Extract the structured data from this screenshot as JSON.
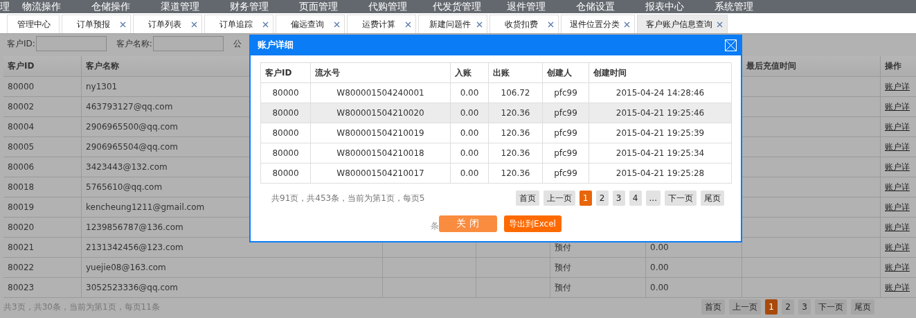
{
  "nav": [
    "理",
    "物流操作",
    "仓储操作",
    "渠道管理",
    "财务管理",
    "页面管理",
    "代购管理",
    "代发货管理",
    "退件管理",
    "仓储设置",
    "报表中心",
    "系统管理"
  ],
  "tabs": [
    {
      "label": "管理中心",
      "closable": false,
      "selected": false
    },
    {
      "label": "订单预报",
      "closable": true,
      "selected": false
    },
    {
      "label": "订单列表",
      "closable": true,
      "selected": false
    },
    {
      "label": "订单追踪",
      "closable": true,
      "selected": false
    },
    {
      "label": "偏远查询",
      "closable": true,
      "selected": false
    },
    {
      "label": "运费计算",
      "closable": true,
      "selected": false
    },
    {
      "label": "新建问题件",
      "closable": true,
      "selected": false
    },
    {
      "label": "收货扣费",
      "closable": true,
      "selected": false
    },
    {
      "label": "退件位置分类",
      "closable": true,
      "selected": false
    },
    {
      "label": "客户账户信息查询",
      "closable": true,
      "selected": true
    }
  ],
  "search": {
    "fields": [
      {
        "label": "客户ID:",
        "kind": "input"
      },
      {
        "label": "客户名称:",
        "kind": "input"
      },
      {
        "label": "公",
        "kind": "label"
      }
    ]
  },
  "table": {
    "columns": [
      "客户ID",
      "客户名称",
      "最后充值时间",
      "操作"
    ],
    "rows": [
      {
        "id": "80000",
        "name": "ny1301",
        "action": "账户详"
      },
      {
        "id": "80002",
        "name": "463793127@qq.com",
        "action": "账户详"
      },
      {
        "id": "80004",
        "name": "2906965500@qq.com",
        "action": "账户详"
      },
      {
        "id": "80005",
        "name": "2906965504@qq.com",
        "action": "账户详"
      },
      {
        "id": "80006",
        "name": "3423443@132.com",
        "action": "账户详"
      },
      {
        "id": "80018",
        "name": "5765610@qq.com",
        "action": "账户详"
      },
      {
        "id": "80019",
        "name": "kencheung1211@gmail.com",
        "action": "账户详"
      },
      {
        "id": "80020",
        "name": "1239856787@136.com",
        "action": "账户详"
      },
      {
        "id": "80021",
        "name": "2131342456@123.com",
        "column_5": "预付",
        "column_6": "0.00",
        "action": "账户详"
      },
      {
        "id": "80022",
        "name": "yuejie08@163.com",
        "column_5": "预付",
        "column_6": "0.00",
        "action": "账户详"
      },
      {
        "id": "80023",
        "name": "3052523336@qq.com",
        "column_5": "预付",
        "column_6": "0.00",
        "action": "账户详"
      }
    ]
  },
  "pager": {
    "info": "共3页，共30条，当前为第1页，每页11条",
    "buttons": [
      {
        "label": "首页",
        "kind": "nav",
        "selected": false
      },
      {
        "label": "上一页",
        "kind": "nav",
        "selected": false
      },
      {
        "label": "1",
        "kind": "page",
        "selected": true
      },
      {
        "label": "2",
        "kind": "page",
        "selected": false
      },
      {
        "label": "3",
        "kind": "page",
        "selected": false
      },
      {
        "label": "下一页",
        "kind": "nav",
        "selected": false
      },
      {
        "label": "尾页",
        "kind": "nav",
        "selected": false
      }
    ]
  },
  "dialog": {
    "title": "账户详细",
    "columns": [
      "客户ID",
      "流水号",
      "入账",
      "出账",
      "创建人",
      "创建时间"
    ],
    "rows": [
      {
        "cells": [
          "80000",
          "W800001504240001",
          "0.00",
          "106.72",
          "pfc99",
          "2015-04-24 14:28:46"
        ],
        "selected": false
      },
      {
        "cells": [
          "80000",
          "W800001504210020",
          "0.00",
          "120.36",
          "pfc99",
          "2015-04-21 19:25:46"
        ],
        "selected": true
      },
      {
        "cells": [
          "80000",
          "W800001504210019",
          "0.00",
          "120.36",
          "pfc99",
          "2015-04-21 19:25:39"
        ],
        "selected": false
      },
      {
        "cells": [
          "80000",
          "W800001504210018",
          "0.00",
          "120.36",
          "pfc99",
          "2015-04-21 19:25:34"
        ],
        "selected": false
      },
      {
        "cells": [
          "80000",
          "W800001504210017",
          "0.00",
          "120.36",
          "pfc99",
          "2015-04-21 19:25:28"
        ],
        "selected": false
      }
    ],
    "pager": {
      "info": "共91页，共453条，当前为第1页，每页5",
      "buttons": [
        {
          "label": "首页",
          "kind": "nav",
          "selected": false
        },
        {
          "label": "上一页",
          "kind": "nav",
          "selected": false
        },
        {
          "label": "1",
          "kind": "page",
          "selected": true
        },
        {
          "label": "2",
          "kind": "page",
          "selected": false
        },
        {
          "label": "3",
          "kind": "page",
          "selected": false
        },
        {
          "label": "4",
          "kind": "page",
          "selected": false
        },
        {
          "label": "...",
          "kind": "page",
          "selected": false
        },
        {
          "label": "下一页",
          "kind": "nav",
          "selected": false
        },
        {
          "label": "尾页",
          "kind": "nav",
          "selected": false
        }
      ]
    },
    "wrap": "条",
    "actions": [
      {
        "label": "关 闭",
        "kind": "close"
      },
      {
        "label": "导出到Excel",
        "kind": "export"
      }
    ]
  }
}
